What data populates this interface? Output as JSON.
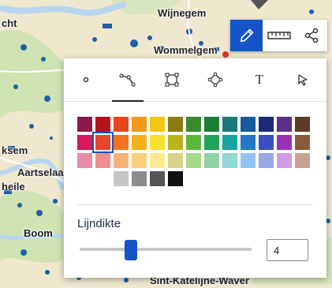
{
  "map": {
    "labels": [
      {
        "id": "wijnegem",
        "text": "Wijnegem"
      },
      {
        "id": "wommelgem",
        "text": "Wommelgem"
      },
      {
        "id": "cht",
        "text": "cht"
      },
      {
        "id": "ksem",
        "text": "ksem"
      },
      {
        "id": "aartselaar",
        "text": "Aartselaa"
      },
      {
        "id": "heile",
        "text": "heile"
      },
      {
        "id": "boom",
        "text": "Boom"
      },
      {
        "id": "sint-katelijne",
        "text": "Sint-Katelijne-Waver"
      }
    ]
  },
  "toolbar": {
    "draw_icon": "pencil-icon",
    "measure_icon": "ruler-icon",
    "share_icon": "share-icon"
  },
  "panel": {
    "tabs": [
      {
        "id": "point",
        "icon": "point-icon"
      },
      {
        "id": "line",
        "icon": "polyline-icon",
        "active": true
      },
      {
        "id": "rectangle",
        "icon": "rectangle-icon"
      },
      {
        "id": "polygon",
        "icon": "polygon-icon"
      },
      {
        "id": "text",
        "label": "T",
        "icon": "text-icon"
      },
      {
        "id": "select",
        "icon": "cursor-arrow-icon"
      }
    ],
    "colors": [
      [
        "#8b1a4a",
        "#b31417",
        "#e4451a",
        "#f19a1c",
        "#f3c612",
        "#8c7c0f",
        "#3a8a2e",
        "#1a7e35",
        "#187a7a",
        "#155a9b",
        "#1e2b7a",
        "#5f2f8f",
        "#5c3b26"
      ],
      [
        "#d6185c",
        "#e8442e",
        "#f3741f",
        "#f7b018",
        "#f7e02a",
        "#b7b41a",
        "#5bb83b",
        "#21a45b",
        "#16a3a2",
        "#2277c7",
        "#3a4fc2",
        "#9a2fb8",
        "#8a5a3c"
      ],
      [
        "#e98aa7",
        "#f08d8d",
        "#f7b27a",
        "#f9cf7a",
        "#fbea8f",
        "#d8d487",
        "#a6d98a",
        "#8fd3a4",
        "#8fd9d4",
        "#92c2ef",
        "#9aa6e6",
        "#d39be3",
        "#c8a192"
      ],
      [
        "#ffffff",
        "#c5c5c5",
        "#8c8c8c",
        "#555555",
        "#111111"
      ]
    ],
    "selected_color": "#e8442e",
    "stroke_width_label": "Lijndikte",
    "stroke_width_value": "4",
    "stroke_width_fraction": 0.3
  }
}
